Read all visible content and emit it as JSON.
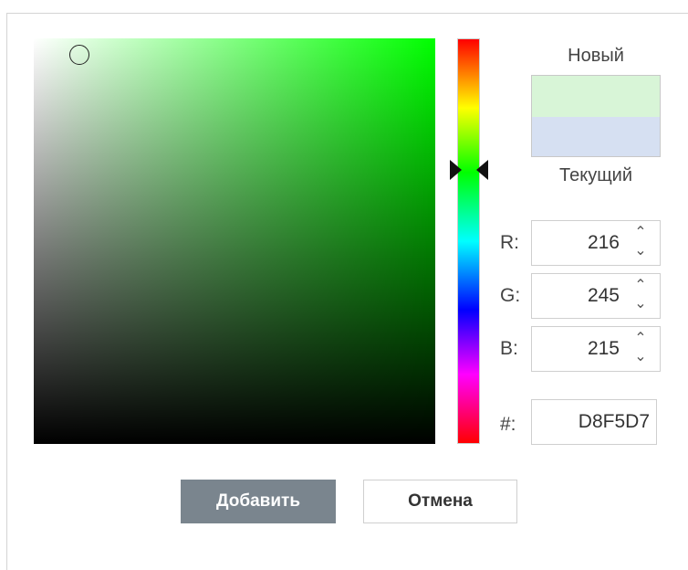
{
  "picker": {
    "new_label": "Новый",
    "current_label": "Текущий",
    "new_color": "#D8F5D7",
    "current_color": "#D6E0F2",
    "hue_color": "#00ff00",
    "fields": {
      "r": {
        "label": "R:",
        "value": "216"
      },
      "g": {
        "label": "G:",
        "value": "245"
      },
      "b": {
        "label": "B:",
        "value": "215"
      },
      "hex": {
        "label": "#:",
        "value": "D8F5D7"
      }
    },
    "spin_up_icon": "chevron-up-icon",
    "spin_down_icon": "chevron-down-icon"
  },
  "buttons": {
    "add_label": "Добавить",
    "cancel_label": "Отмена",
    "add_color": "#7a858e"
  }
}
